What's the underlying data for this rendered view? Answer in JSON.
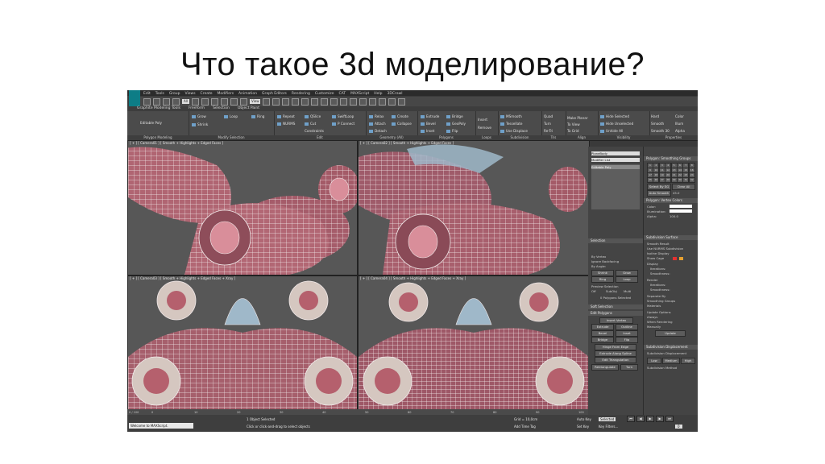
{
  "slide": {
    "title": "Что такое 3d моделирование?"
  },
  "app": {
    "menu": [
      "Edit",
      "Tools",
      "Group",
      "Views",
      "Create",
      "Modifiers",
      "Animation",
      "Graph Editors",
      "Rendering",
      "Customize",
      "CAT",
      "MAXScript",
      "Help",
      "3DCrawl"
    ],
    "toolbar": {
      "selection_filter": "All",
      "view_dropdown": "View"
    },
    "ribbon_tabs": [
      "Graphite Modeling Tools",
      "Freeform",
      "Selection",
      "Object Paint"
    ],
    "ribbon_groups": [
      {
        "label": "Polygon Modeling",
        "items": [
          "Editable Poly"
        ]
      },
      {
        "label": "Modify Selection",
        "items": [
          "Grow",
          "Shrink",
          "Loop",
          "Ring"
        ]
      },
      {
        "label": "Edit",
        "items": [
          "Repeat",
          "QSlice",
          "SwiftLoop",
          "NURMS",
          "Cut",
          "P Connect",
          "Constraints"
        ]
      },
      {
        "label": "Geometry (All)",
        "items": [
          "Relax",
          "Create",
          "Attach",
          "Collapse",
          "Detach"
        ]
      },
      {
        "label": "Polygons",
        "items": [
          "Extrude",
          "Bevel",
          "Inset",
          "Bridge",
          "GeoPoly",
          "Flip"
        ]
      },
      {
        "label": "Loops",
        "items": [
          "Insert",
          "Remove"
        ]
      },
      {
        "label": "Subdivision",
        "items": [
          "MSmooth",
          "Tessellate",
          "Use Displace"
        ]
      },
      {
        "label": "Tris",
        "items": [
          "Quad",
          "Turn",
          "Re-Tri"
        ]
      },
      {
        "label": "Align",
        "items": [
          "Make Planar",
          "To View",
          "To Grid"
        ]
      },
      {
        "label": "Visibility",
        "items": [
          "Hide Selected",
          "Hide Unselected",
          "Unhide All"
        ]
      },
      {
        "label": "Properties",
        "items": [
          "Hard",
          "Smooth",
          "Smooth 30",
          "Color",
          "Illum",
          "Alpha"
        ]
      }
    ],
    "viewports": [
      {
        "label": "[ + ] [ Camera01 ] [ Smooth + Highlights + Edged Faces ]"
      },
      {
        "label": "[ + ] [ Camera02 ] [ Smooth + Highlights + Edged Faces ]"
      },
      {
        "label": "[ + ] [ Camera03 ] [ Smooth + Highlights + Edged Faces + Xray ]"
      },
      {
        "label": "[ + ] [ Camera04 ] [ Smooth + Highlights + Edged Faces + Xray ]"
      }
    ],
    "command_panel": {
      "object_name": "PlaneBody",
      "modifier_list": "Modifier List",
      "stack_item": "Editable Poly",
      "selection": {
        "header": "Selection",
        "options": [
          "By Vertex",
          "Ignore Backfacing",
          "By Angle:"
        ],
        "buttons": [
          "Shrink",
          "Grow",
          "Ring",
          "Loop"
        ],
        "preview_label": "Preview Selection",
        "preview_options": [
          "Off",
          "SubObj",
          "Multi"
        ],
        "status": "0 Polygons Selected"
      },
      "soft_selection": "Soft Selection",
      "edit_polygons": {
        "header": "Edit Polygons",
        "insert_vertex": "Insert Vertex",
        "buttons": [
          "Extrude",
          "Outline",
          "Bevel",
          "Inset",
          "Bridge",
          "Flip",
          "Hinge From Edge",
          "Extrude Along Spline",
          "Edit Triangulation",
          "Retriangulate",
          "Turn"
        ]
      },
      "smoothing": {
        "header": "Polygon: Smoothing Groups",
        "groups": [
          "1",
          "2",
          "3",
          "4",
          "5",
          "6",
          "7",
          "8",
          "9",
          "10",
          "11",
          "12",
          "13",
          "14",
          "15",
          "16",
          "17",
          "18",
          "19",
          "20",
          "21",
          "22",
          "23",
          "24",
          "25",
          "26",
          "27",
          "28",
          "29",
          "30",
          "31",
          "32"
        ],
        "select_by": "Select By SG",
        "clear_all": "Clear All",
        "auto_smooth": "Auto Smooth",
        "auto_value": "45.0"
      },
      "vertex_colors": {
        "header": "Polygon: Vertex Colors",
        "color_label": "Color:",
        "illumination_label": "Illumination:",
        "alpha_label": "Alpha:",
        "alpha_value": "100.0"
      },
      "subdivision_surface": {
        "header": "Subdivision Surface",
        "options": [
          "Smooth Result",
          "Use NURMS Subdivision",
          "Isoline Display",
          "Show Cage"
        ],
        "display_label": "Display",
        "iterations_label": "Iterations:",
        "smoothness_label": "Smoothness:",
        "render_label": "Render",
        "separate_by": "Separate By",
        "separate_options": [
          "Smoothing Groups",
          "Materials"
        ],
        "update_options_label": "Update Options",
        "update_options": [
          "Always",
          "When Rendering",
          "Manually"
        ],
        "update_button": "Update"
      },
      "subdivision_displacement": {
        "header": "Subdivision Displacement",
        "option": "Subdivision Displacement",
        "presets": [
          "Low",
          "Medium",
          "High"
        ],
        "method_label": "Subdivision Method"
      }
    },
    "timeline": {
      "frame_label": "0 / 100",
      "ticks": [
        "0",
        "10",
        "20",
        "30",
        "40",
        "50",
        "60",
        "70",
        "80",
        "90",
        "100"
      ]
    },
    "status": {
      "welcome": "Welcome to MAXScript.",
      "selected": "1 Object Selected",
      "prompt": "Click or click-and-drag to select objects",
      "grid": "Grid = 10,0cm",
      "add_time_tag": "Add Time Tag",
      "auto_key": "Auto Key",
      "set_key": "Set Key",
      "selected_dropdown": "Selected",
      "key_filters": "Key Filters...",
      "frame": "0"
    },
    "colors": {
      "accent": "#0d7d86",
      "viewport_bg": "#5a5a5a",
      "model_color": "#b86a74",
      "wire": "#f5f5f5"
    }
  }
}
